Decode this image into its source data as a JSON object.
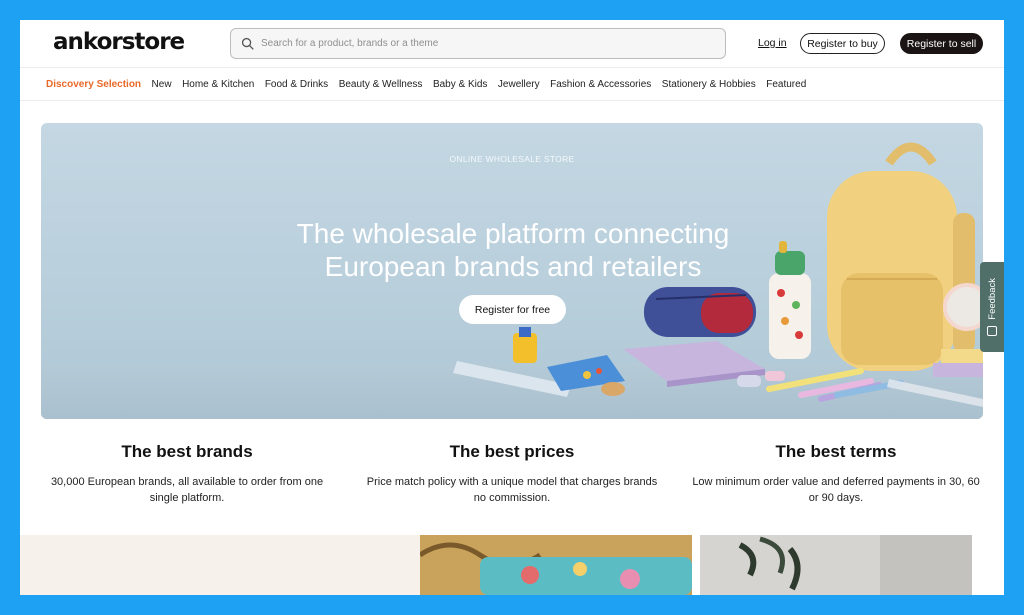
{
  "header": {
    "logo": "ankorstore",
    "search_placeholder": "Search for a product, brands or a theme",
    "login_label": "Log in",
    "register_buy_label": "Register to buy",
    "register_sell_label": "Register to sell"
  },
  "nav": {
    "items": [
      {
        "label": "Discovery Selection"
      },
      {
        "label": "New"
      },
      {
        "label": "Home & Kitchen"
      },
      {
        "label": "Food & Drinks"
      },
      {
        "label": "Beauty & Wellness"
      },
      {
        "label": "Baby & Kids"
      },
      {
        "label": "Jewellery"
      },
      {
        "label": "Fashion & Accessories"
      },
      {
        "label": "Stationery & Hobbies"
      },
      {
        "label": "Featured"
      }
    ]
  },
  "hero": {
    "eyebrow": "ONLINE WHOLESALE STORE",
    "title": "The wholesale platform connecting European brands and retailers",
    "cta_label": "Register for free"
  },
  "feedback": {
    "label": "Feedback"
  },
  "features": [
    {
      "title": "The best brands",
      "text": "30,000 European brands, all available to order from one single platform."
    },
    {
      "title": "The best prices",
      "text": "Price match policy with a unique model that charges brands no commission."
    },
    {
      "title": "The best terms",
      "text": "Low minimum order value and deferred payments in 30, 60 or 90 days."
    }
  ],
  "colors": {
    "accent": "#e8692a",
    "dark_button": "#1a1414",
    "frame": "#1ea1f2"
  }
}
